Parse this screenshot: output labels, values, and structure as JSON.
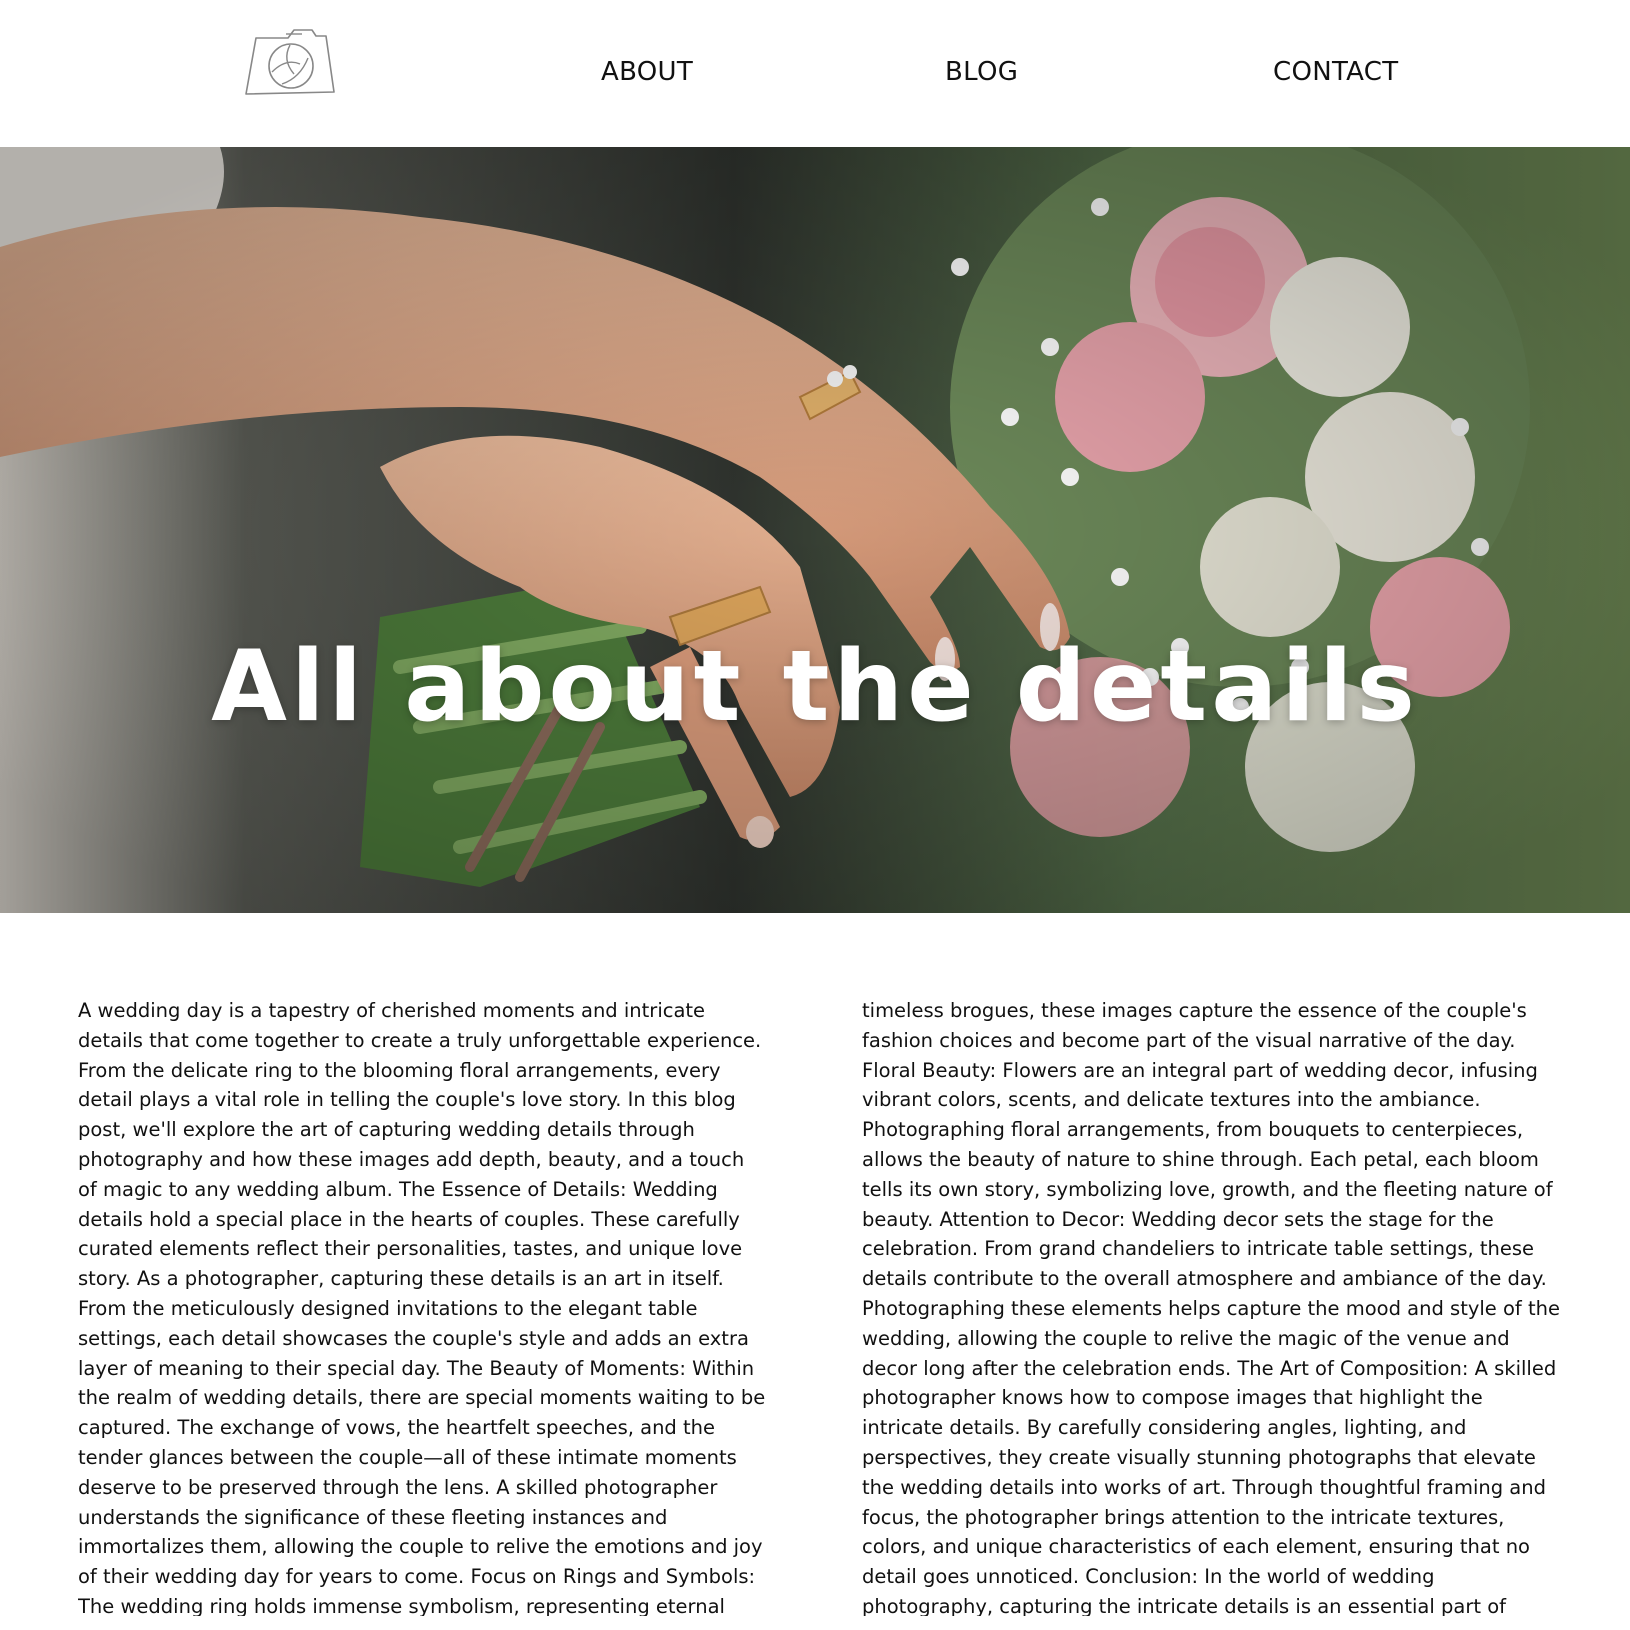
{
  "nav": {
    "logo_icon": "camera-logo-icon",
    "links": [
      "ABOUT",
      "BLOG",
      "CONTACT"
    ]
  },
  "hero": {
    "title": "All about the details"
  },
  "article": {
    "col_left": "A wedding day is a tapestry of cherished moments and intricate details that come together to create a truly unforgettable experience. From the delicate ring to the blooming floral arrangements, every detail plays a vital role in telling the couple's love story. In this blog post, we'll explore the art of capturing wedding details through photography and how these images add depth, beauty, and a touch of magic to any wedding album. The Essence of Details: Wedding details hold a special place in the hearts of couples. These carefully curated elements reflect their personalities, tastes, and unique love story. As a photographer, capturing these details is an art in itself. From the meticulously designed invitations to the elegant table settings, each detail showcases the couple's style and adds an extra layer of meaning to their special day. The Beauty of Moments: Within the realm of wedding details, there are special moments waiting to be captured. The exchange of vows, the heartfelt speeches, and the tender glances between the couple—all of these intimate moments deserve to be preserved through the lens. A skilled photographer understands the significance of these fleeting instances and immortalizes them, allowing the couple to relive the emotions and joy of their wedding day for years to come. Focus on Rings and Symbols: The wedding ring holds immense symbolism, representing eternal love and commitment. Photographing the rings in creative ways adds a touch of artistry to the wedding album. From",
    "col_right": "timeless brogues, these images capture the essence of the couple's fashion choices and become part of the visual narrative of the day. Floral Beauty: Flowers are an integral part of wedding decor, infusing vibrant colors, scents, and delicate textures into the ambiance. Photographing floral arrangements, from bouquets to centerpieces, allows the beauty of nature to shine through. Each petal, each bloom tells its own story, symbolizing love, growth, and the fleeting nature of beauty. Attention to Decor: Wedding decor sets the stage for the celebration. From grand chandeliers to intricate table settings, these details contribute to the overall atmosphere and ambiance of the day. Photographing these elements helps capture the mood and style of the wedding, allowing the couple to relive the magic of the venue and decor long after the celebration ends. The Art of Composition: A skilled photographer knows how to compose images that highlight the intricate details. By carefully considering angles, lighting, and perspectives, they create visually stunning photographs that elevate the wedding details into works of art. Through thoughtful framing and focus, the photographer brings attention to the intricate textures, colors, and unique characteristics of each element, ensuring that no detail goes unnoticed. Conclusion: In the world of wedding photography, capturing the intricate details is an essential part of telling the couple's love story. From the smallest nuances to grand"
  }
}
